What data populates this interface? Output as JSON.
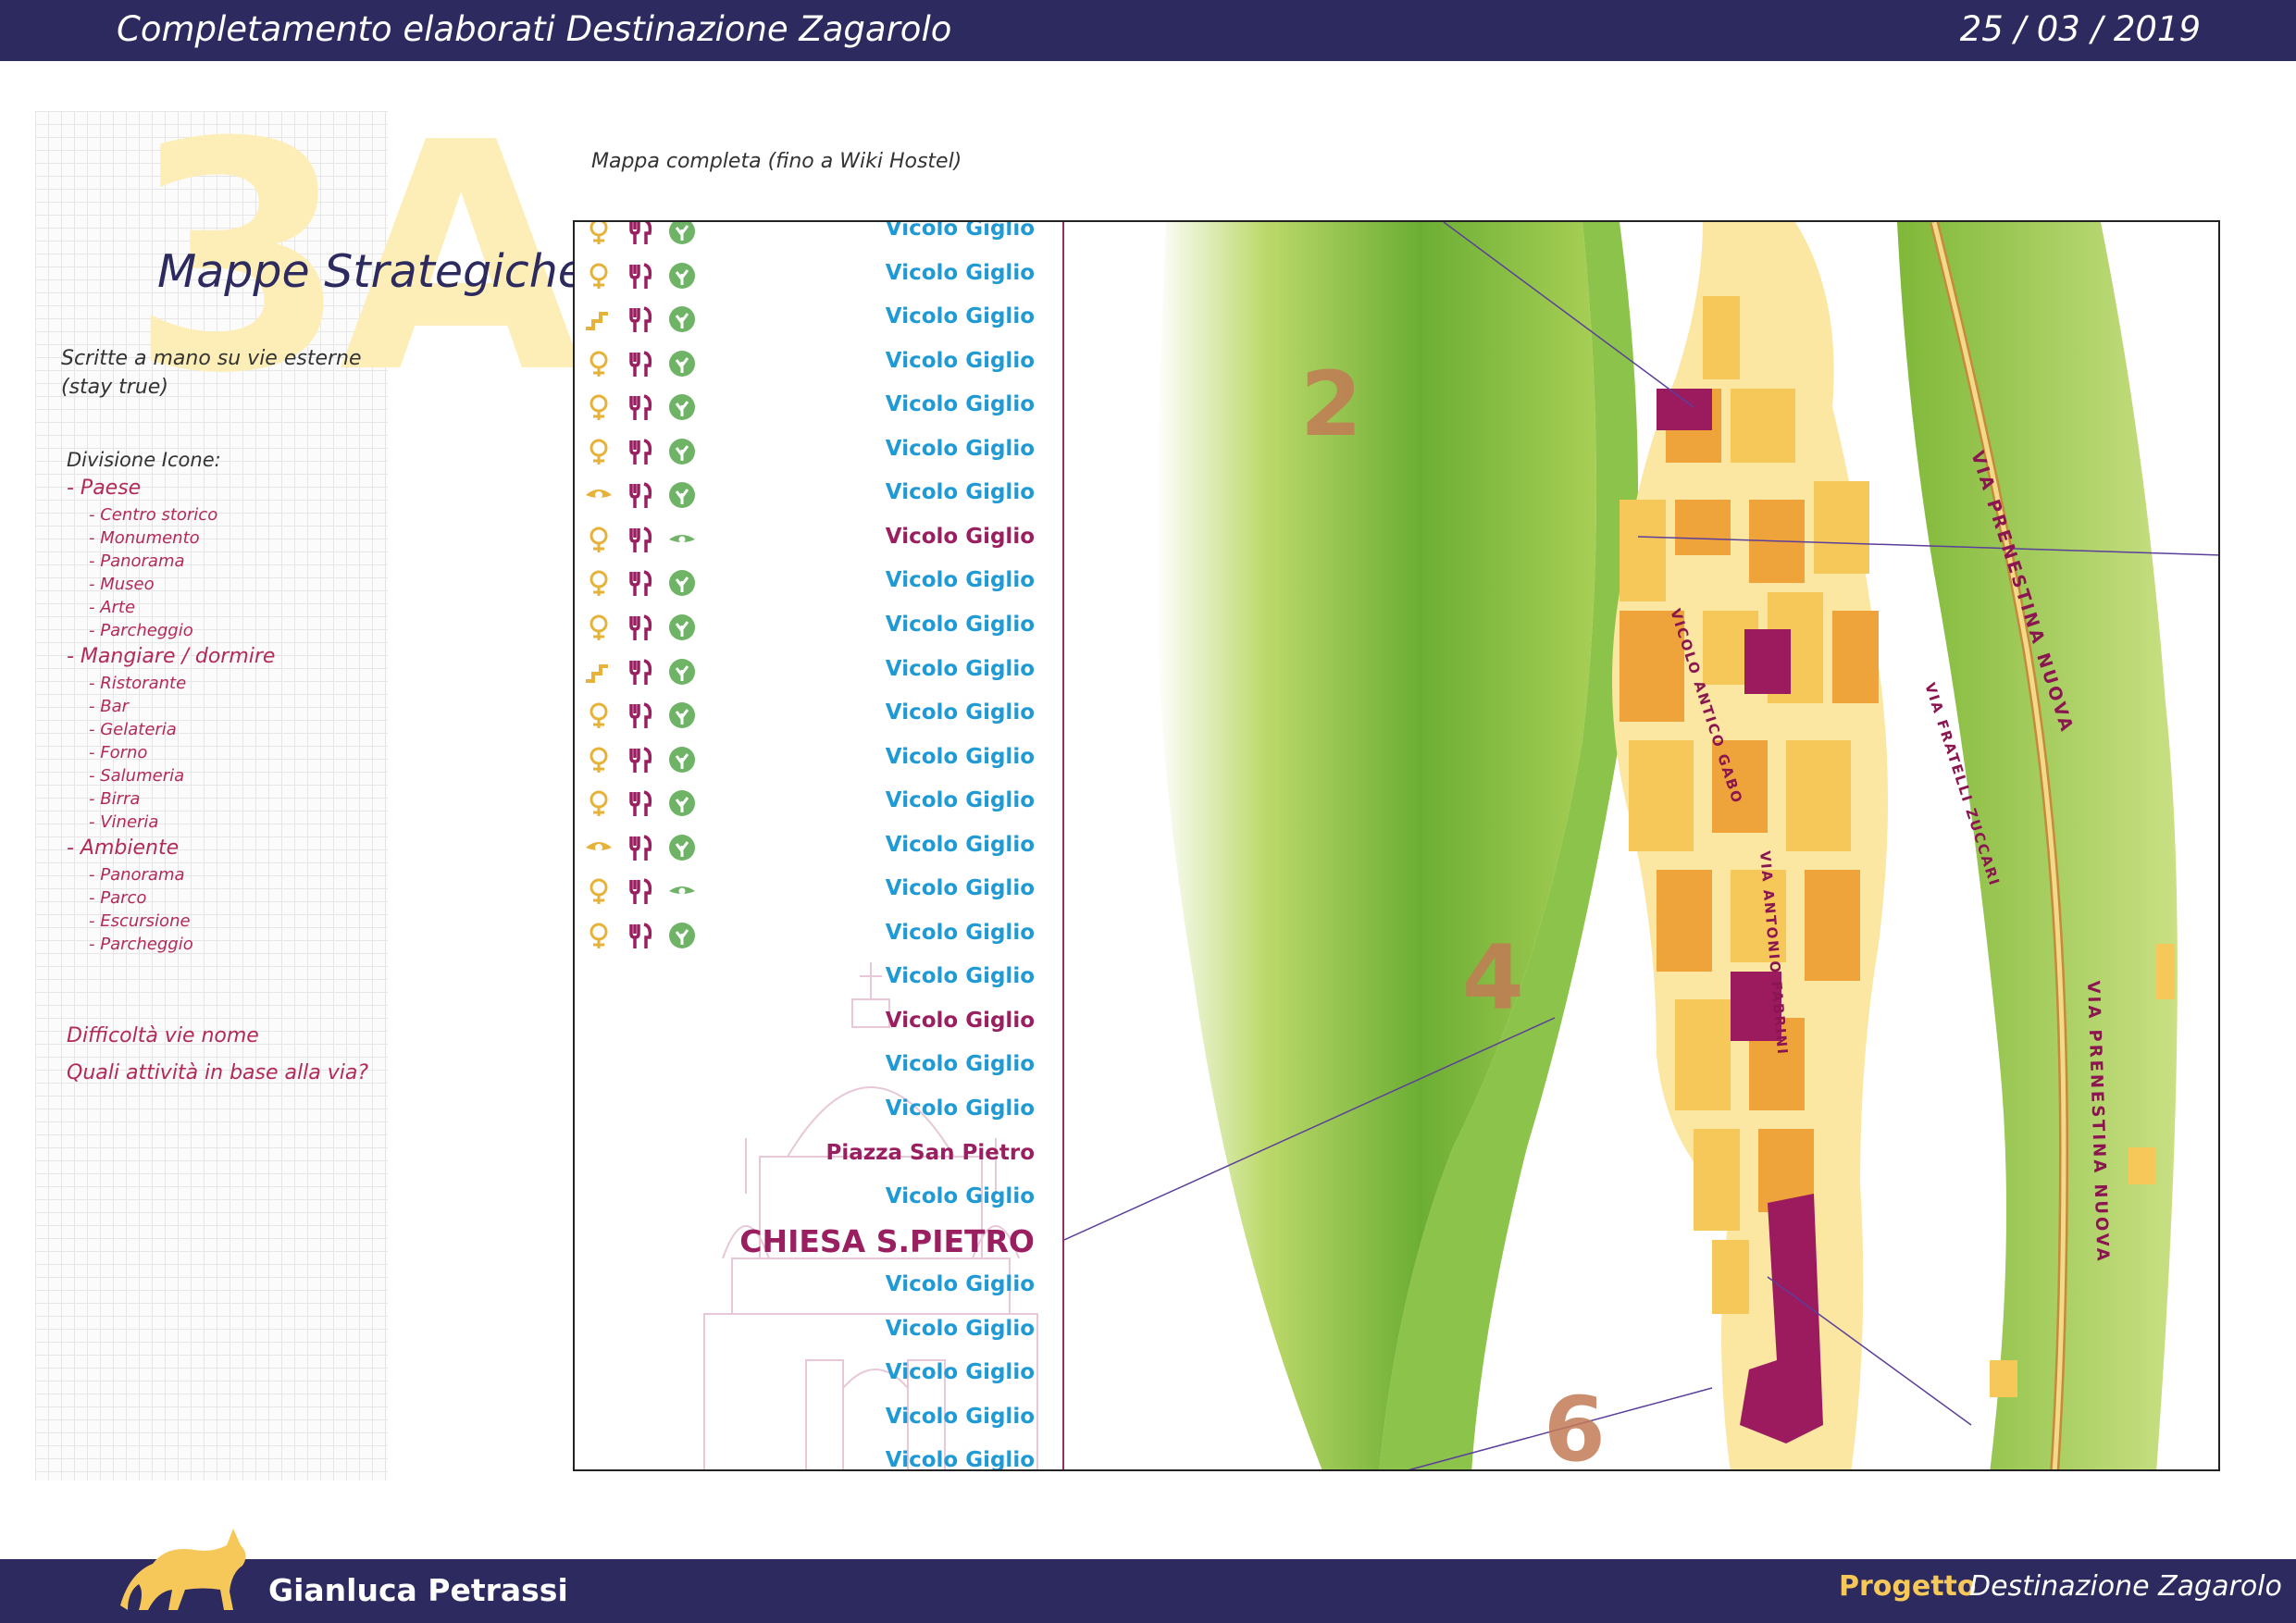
{
  "header": {
    "title": "Completamento elaborati Destinazione Zagarolo",
    "date": "25 / 03 / 2019"
  },
  "footer": {
    "author": "Gianluca Petrassi",
    "project_label": "Progetto",
    "project_name": "Destinazione Zagarolo"
  },
  "sidebar": {
    "section_number": "3A",
    "heading": "Mappe Strategiche",
    "note_line1": "Scritte a mano su vie esterne",
    "note_line2": "(stay true)",
    "icons_title": "Divisione Icone:",
    "categories": [
      {
        "label": "- Paese",
        "items": [
          "- Centro storico",
          "- Monumento",
          "- Panorama",
          "- Museo",
          "- Arte",
          "- Parcheggio"
        ]
      },
      {
        "label": "- Mangiare / dormire",
        "items": [
          "- Ristorante",
          "- Bar",
          "- Gelateria",
          "- Forno",
          "- Salumeria",
          "- Birra",
          "- Vineria"
        ]
      },
      {
        "label": "- Ambiente",
        "items": [
          "- Panorama",
          "- Parco",
          "- Escursione",
          "- Parcheggio"
        ]
      }
    ],
    "question1": "Difficoltà vie nome",
    "question2": "Quali attività in base alla via?"
  },
  "map": {
    "caption": "Mappa completa (fino a Wiki Hostel)",
    "colors": {
      "street_blue": "#1f9ad4",
      "street_magenta": "#9a1f60",
      "icon_gold": "#e6b23a",
      "icon_green": "#6fb466",
      "building_yellow": "#f6c85a",
      "building_orange": "#eea43a",
      "building_magenta": "#9c1b5f",
      "grass_green": "#7fb838"
    },
    "streets": [
      {
        "name": "Vicolo Giglio",
        "style": "blue",
        "icons": [
          "pin",
          "fork",
          "leaf"
        ]
      },
      {
        "name": "Vicolo Giglio",
        "style": "blue",
        "icons": [
          "pin",
          "fork",
          "leaf"
        ]
      },
      {
        "name": "Vicolo Giglio",
        "style": "blue",
        "icons": [
          "stairs",
          "fork",
          "leaf"
        ]
      },
      {
        "name": "Vicolo Giglio",
        "style": "blue",
        "icons": [
          "pin",
          "fork",
          "leaf"
        ]
      },
      {
        "name": "Vicolo Giglio",
        "style": "blue",
        "icons": [
          "pin",
          "fork",
          "leaf"
        ]
      },
      {
        "name": "Vicolo Giglio",
        "style": "blue",
        "icons": [
          "pin",
          "fork",
          "leaf"
        ]
      },
      {
        "name": "Vicolo Giglio",
        "style": "blue",
        "icons": [
          "eye",
          "fork",
          "leaf"
        ]
      },
      {
        "name": "Vicolo Giglio",
        "style": "magenta",
        "icons": [
          "pin",
          "fork",
          "eye-green"
        ]
      },
      {
        "name": "Vicolo Giglio",
        "style": "blue",
        "icons": [
          "pin",
          "fork",
          "leaf"
        ]
      },
      {
        "name": "Vicolo Giglio",
        "style": "blue",
        "icons": [
          "pin",
          "fork",
          "leaf"
        ]
      },
      {
        "name": "Vicolo Giglio",
        "style": "blue",
        "icons": [
          "stairs",
          "fork",
          "leaf"
        ]
      },
      {
        "name": "Vicolo Giglio",
        "style": "blue",
        "icons": [
          "pin",
          "fork",
          "leaf"
        ]
      },
      {
        "name": "Vicolo Giglio",
        "style": "blue",
        "icons": [
          "pin",
          "fork",
          "leaf"
        ]
      },
      {
        "name": "Vicolo Giglio",
        "style": "blue",
        "icons": [
          "pin",
          "fork",
          "leaf"
        ]
      },
      {
        "name": "Vicolo Giglio",
        "style": "blue",
        "icons": [
          "eye",
          "fork",
          "leaf"
        ]
      },
      {
        "name": "Vicolo Giglio",
        "style": "blue",
        "icons": [
          "pin",
          "fork",
          "eye-green"
        ]
      },
      {
        "name": "Vicolo Giglio",
        "style": "blue",
        "icons": [
          "pin",
          "fork",
          "leaf"
        ]
      },
      {
        "name": "Vicolo Giglio",
        "style": "blue",
        "icons": []
      },
      {
        "name": "Vicolo Giglio",
        "style": "magenta",
        "icons": []
      },
      {
        "name": "Vicolo Giglio",
        "style": "blue",
        "icons": []
      },
      {
        "name": "Vicolo Giglio",
        "style": "blue",
        "icons": []
      },
      {
        "name": "Piazza San Pietro",
        "style": "magenta",
        "icons": []
      },
      {
        "name": "Vicolo Giglio",
        "style": "blue",
        "icons": []
      },
      {
        "name": "CHIESA S.PIETRO",
        "style": "landmark",
        "icons": []
      },
      {
        "name": "Vicolo Giglio",
        "style": "blue",
        "icons": []
      },
      {
        "name": "Vicolo Giglio",
        "style": "blue",
        "icons": []
      },
      {
        "name": "Vicolo Giglio",
        "style": "blue",
        "icons": []
      },
      {
        "name": "Vicolo Giglio",
        "style": "blue",
        "icons": []
      },
      {
        "name": "Vicolo Giglio",
        "style": "blue",
        "icons": []
      }
    ],
    "zone_numbers": [
      "2",
      "4",
      "6"
    ],
    "street_labels": [
      "VIA PRENESTINA NUOVA",
      "VIA PRENESTINA NUOVA",
      "VIA FRATELLI ZUCCARI",
      "VICOLO ANTICO GABO",
      "VIA ANTONIO FABRINI"
    ]
  }
}
